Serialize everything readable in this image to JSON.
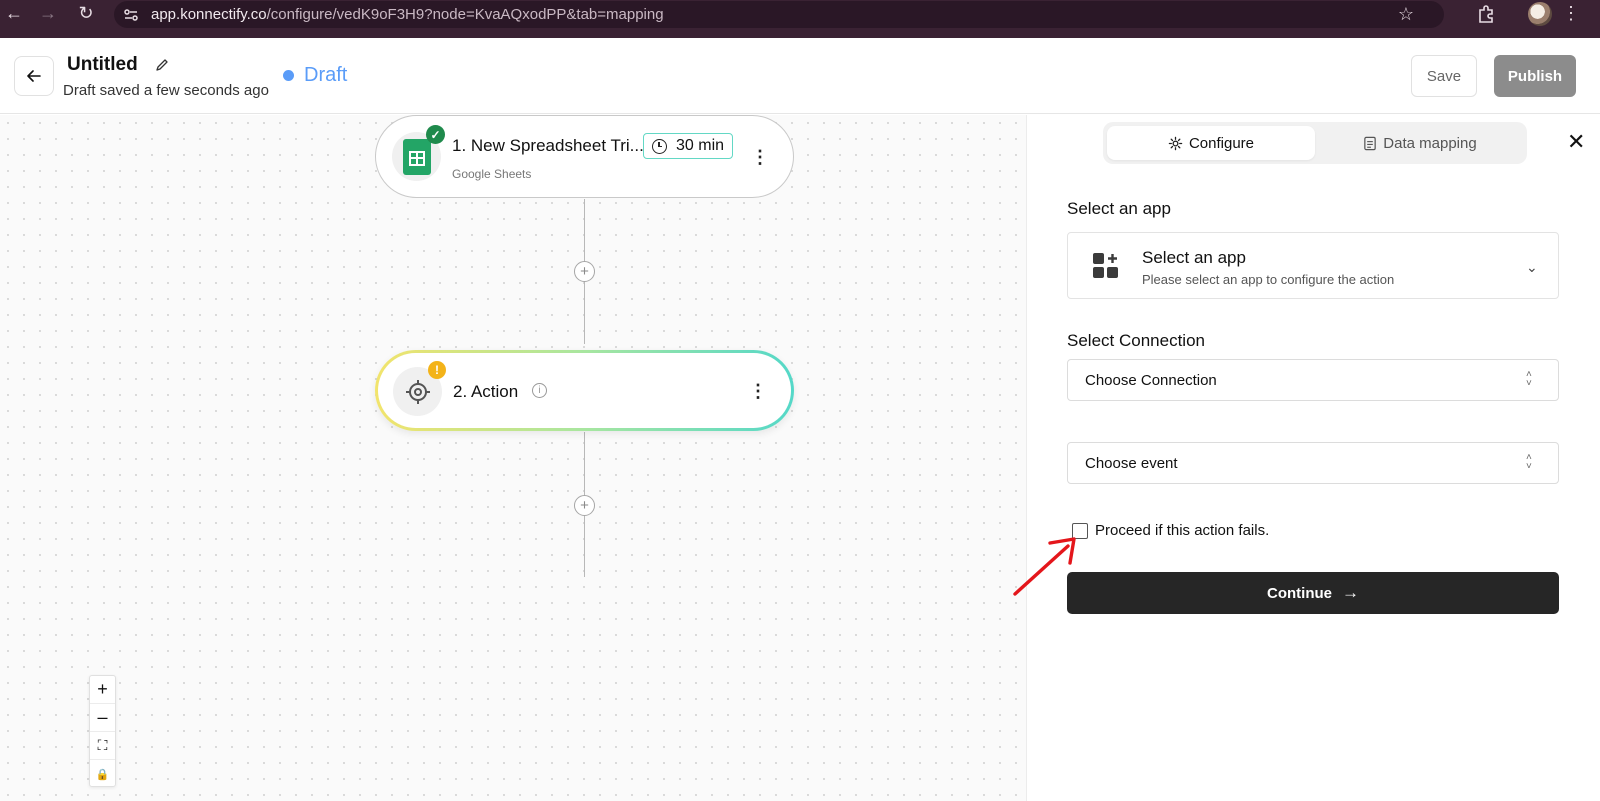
{
  "browser": {
    "url_main": "app.konnectify.co",
    "url_rest": "/configure/vedK9oF3H9?node=KvaAQxodPP&tab=mapping"
  },
  "header": {
    "title": "Untitled",
    "subtitle": "Draft saved a few seconds ago",
    "status": "Draft",
    "save_label": "Save",
    "publish_label": "Publish"
  },
  "canvas": {
    "node1": {
      "title": "1. New Spreadsheet Tri...",
      "app": "Google Sheets",
      "interval": "30 min",
      "icon": "google-sheets-icon",
      "status": "success"
    },
    "node2": {
      "title": "2. Action",
      "icon": "target-icon",
      "status": "warning",
      "warning_badge": "!"
    },
    "zoom": [
      "+",
      "–",
      "⛶",
      "🔒"
    ]
  },
  "panel": {
    "tabs": [
      "Configure",
      "Data mapping"
    ],
    "active_tab": "Configure",
    "select_app_label": "Select an app",
    "app_select_title": "Select an app",
    "app_select_sub": "Please select an app to configure the action",
    "connection_label": "Select Connection",
    "connection_value": "Choose Connection",
    "event_value": "Choose event",
    "proceed_label": "Proceed if this action fails.",
    "continue_label": "Continue"
  },
  "colors": {
    "accent": "#5a9cf8",
    "browser_bar": "#3a2233",
    "sheets_green": "#23a566",
    "warning": "#f3b319",
    "annotation": "#e4161b"
  }
}
